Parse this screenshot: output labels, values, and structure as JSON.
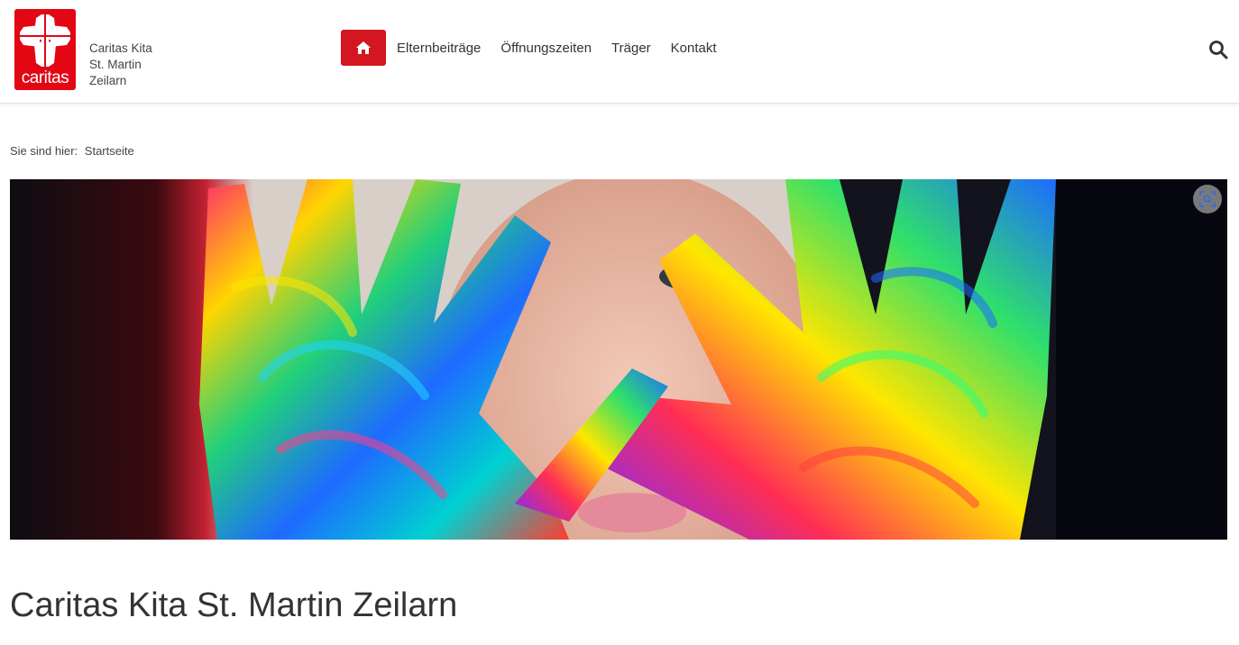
{
  "brand": {
    "logo_word": "caritas",
    "site_name_lines": [
      "Caritas Kita",
      "St. Martin",
      "Zeilarn"
    ],
    "accent_color": "#d3161f",
    "logo_color": "#e30613"
  },
  "nav": {
    "home_icon": "home-icon",
    "items": [
      {
        "label": "Elternbeiträge"
      },
      {
        "label": "Öffnungszeiten"
      },
      {
        "label": "Träger"
      },
      {
        "label": "Kontakt"
      }
    ],
    "search_icon": "search-icon"
  },
  "breadcrumb": {
    "prefix": "Sie sind hier:",
    "current": "Startseite"
  },
  "hero": {
    "image_subject": "child with paint-covered hands",
    "zoom_icon": "zoom-icon"
  },
  "main": {
    "title": "Caritas Kita St. Martin Zeilarn"
  }
}
